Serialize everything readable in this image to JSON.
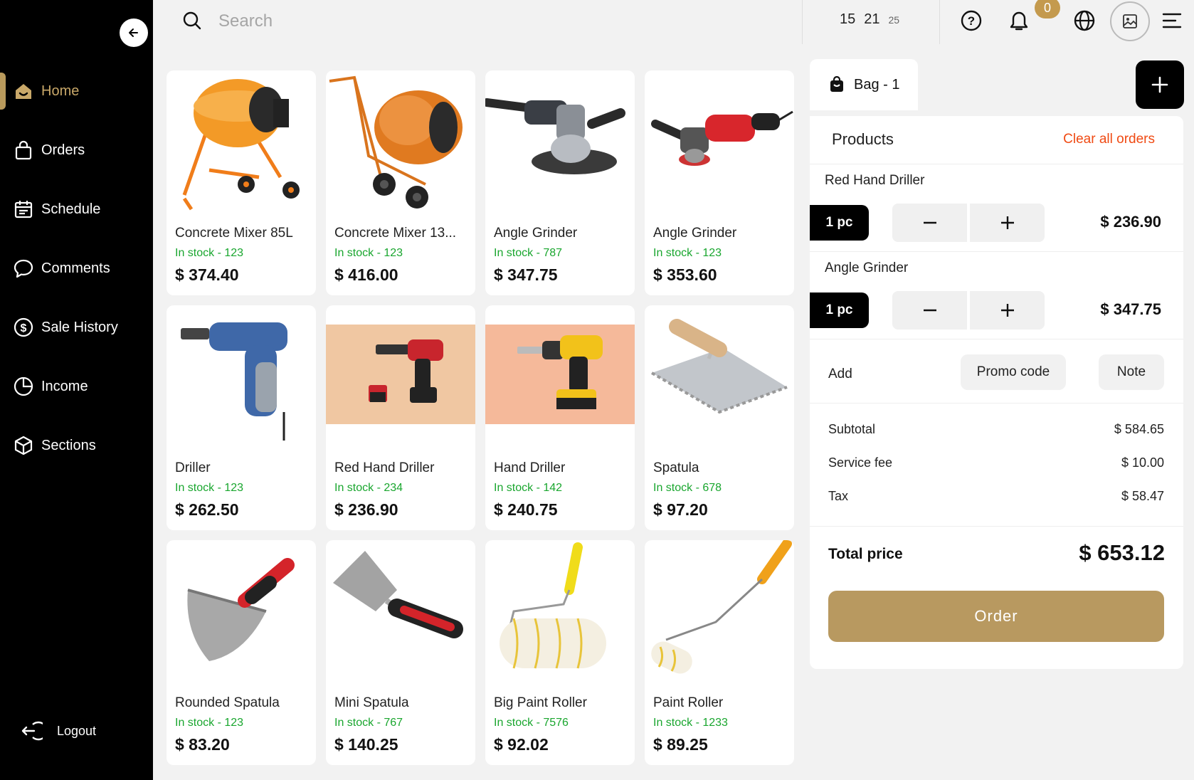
{
  "sidebar": {
    "items": [
      {
        "label": "Home",
        "icon": "home-icon",
        "active": true
      },
      {
        "label": "Orders",
        "icon": "bag-icon"
      },
      {
        "label": "Schedule",
        "icon": "calendar-icon"
      },
      {
        "label": "Comments",
        "icon": "chat-icon"
      },
      {
        "label": "Sale History",
        "icon": "dollar-icon"
      },
      {
        "label": "Income",
        "icon": "pie-chart-icon"
      },
      {
        "label": "Sections",
        "icon": "cube-icon"
      }
    ],
    "logout_label": "Logout"
  },
  "header": {
    "search_placeholder": "Search",
    "clock": {
      "hours": "15",
      "minutes": "21",
      "seconds": "25"
    },
    "notification_count": "0"
  },
  "products": [
    {
      "name": "Concrete Mixer 85L",
      "stock": "In stock - 123",
      "price": "$ 374.40",
      "image": "orange-concrete-mixer"
    },
    {
      "name": "Concrete Mixer 13...",
      "stock": "In stock - 123",
      "price": "$ 416.00",
      "image": "orange-concrete-mixer-wheeled"
    },
    {
      "name": "Angle Grinder",
      "stock": "In stock - 787",
      "price": "$ 347.75",
      "image": "grey-angle-grinder"
    },
    {
      "name": "Angle Grinder",
      "stock": "In stock - 123",
      "price": "$ 353.60",
      "image": "red-angle-grinder"
    },
    {
      "name": "Driller",
      "stock": "In stock - 123",
      "price": "$ 262.50",
      "image": "blue-drill"
    },
    {
      "name": "Red Hand Driller",
      "stock": "In stock - 234",
      "price": "$ 236.90",
      "image": "red-cordless-drill"
    },
    {
      "name": "Hand Driller",
      "stock": "In stock - 142",
      "price": "$ 240.75",
      "image": "yellow-cordless-drill"
    },
    {
      "name": "Spatula",
      "stock": "In stock - 678",
      "price": "$ 97.20",
      "image": "notched-trowel"
    },
    {
      "name": "Rounded Spatula",
      "stock": "In stock - 123",
      "price": "$ 83.20",
      "image": "rounded-spatula"
    },
    {
      "name": "Mini Spatula",
      "stock": "In stock - 767",
      "price": "$ 140.25",
      "image": "mini-spatula"
    },
    {
      "name": "Big Paint Roller",
      "stock": "In stock - 7576",
      "price": "$ 92.02",
      "image": "big-paint-roller"
    },
    {
      "name": "Paint Roller",
      "stock": "In stock - 1233",
      "price": "$ 89.25",
      "image": "paint-roller"
    }
  ],
  "cart": {
    "bag_label": "Bag - 1",
    "title": "Products",
    "clear_label": "Clear all orders",
    "items": [
      {
        "name": "Red Hand Driller",
        "qty": "1 pc",
        "price": "$ 236.90"
      },
      {
        "name": "Angle Grinder",
        "qty": "1 pc",
        "price": "$ 347.75"
      }
    ],
    "add_label": "Add",
    "promo_label": "Promo code",
    "note_label": "Note",
    "summary": [
      {
        "label": "Subtotal",
        "value": "$ 584.65"
      },
      {
        "label": "Service fee",
        "value": "$ 10.00"
      },
      {
        "label": "Tax",
        "value": "$ 58.47"
      }
    ],
    "total_label": "Total price",
    "total_value": "$ 653.12",
    "order_label": "Order"
  },
  "colors": {
    "accent": "#b89960",
    "stock_green": "#19a62e",
    "clear_red": "#f04a13",
    "sidebar_bg": "#000000"
  }
}
